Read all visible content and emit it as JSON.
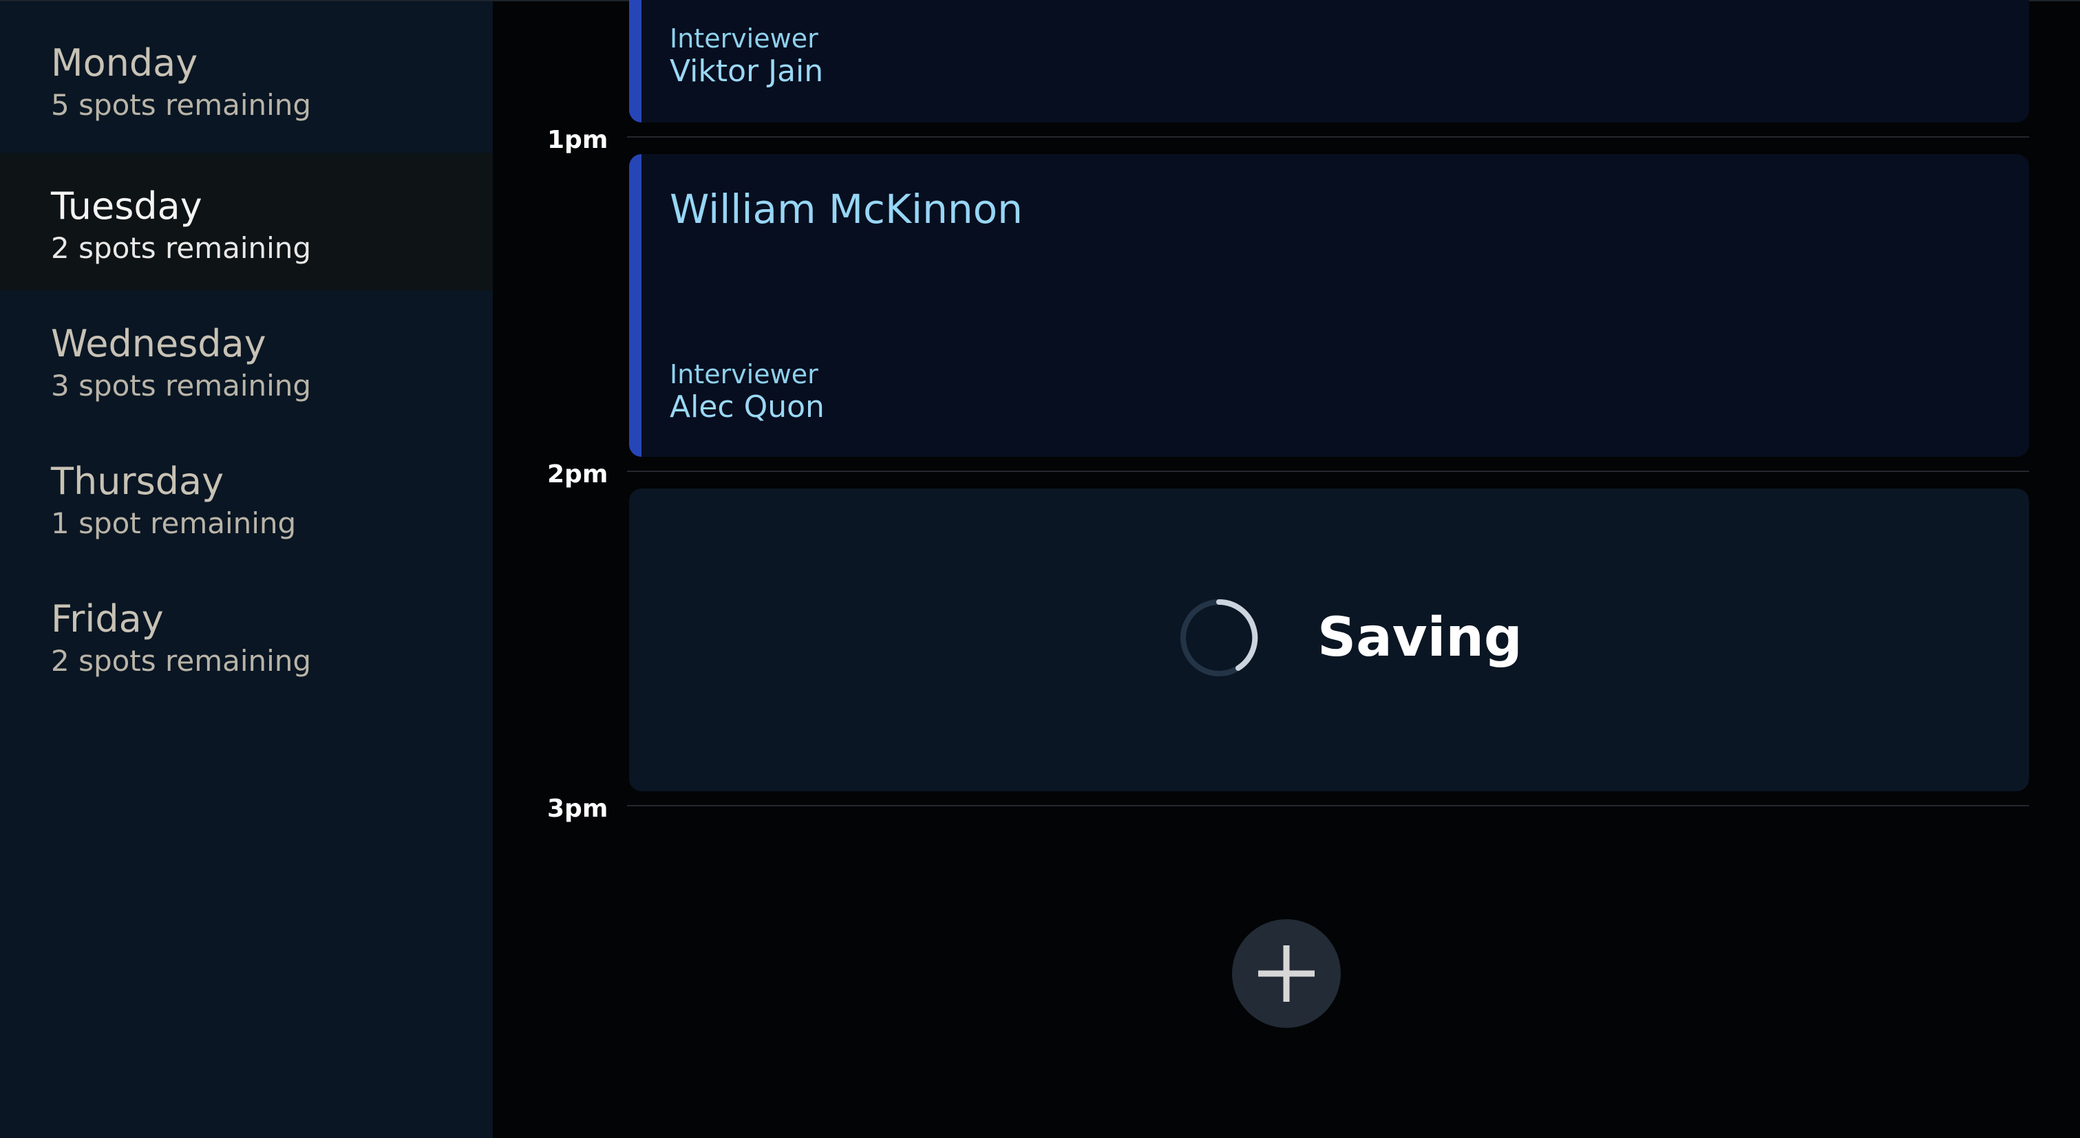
{
  "sidebar": {
    "days": [
      {
        "name": "Monday",
        "spots": "5 spots remaining",
        "selected": false
      },
      {
        "name": "Tuesday",
        "spots": "2 spots remaining",
        "selected": true
      },
      {
        "name": "Wednesday",
        "spots": "3 spots remaining",
        "selected": false
      },
      {
        "name": "Thursday",
        "spots": "1 spot remaining",
        "selected": false
      },
      {
        "name": "Friday",
        "spots": "2 spots remaining",
        "selected": false
      }
    ]
  },
  "schedule": {
    "times": [
      "1pm",
      "2pm",
      "3pm"
    ],
    "appointments": [
      {
        "student": "",
        "interviewer_label": "Interviewer",
        "interviewer": "Viktor Jain"
      },
      {
        "student": "William McKinnon",
        "interviewer_label": "Interviewer",
        "interviewer": "Alec Quon"
      }
    ],
    "saving": {
      "text": "Saving",
      "icon": "spinner-icon"
    },
    "add_button": {
      "icon": "plus-icon"
    }
  },
  "colors": {
    "sidebar_bg": "#0a1623",
    "selected_day_bg": "#0e1316",
    "card_bg": "#070e1f",
    "accent": "#2646b7",
    "interviewer_text": "#9ad8f5",
    "saving_bg": "#0a1623"
  }
}
